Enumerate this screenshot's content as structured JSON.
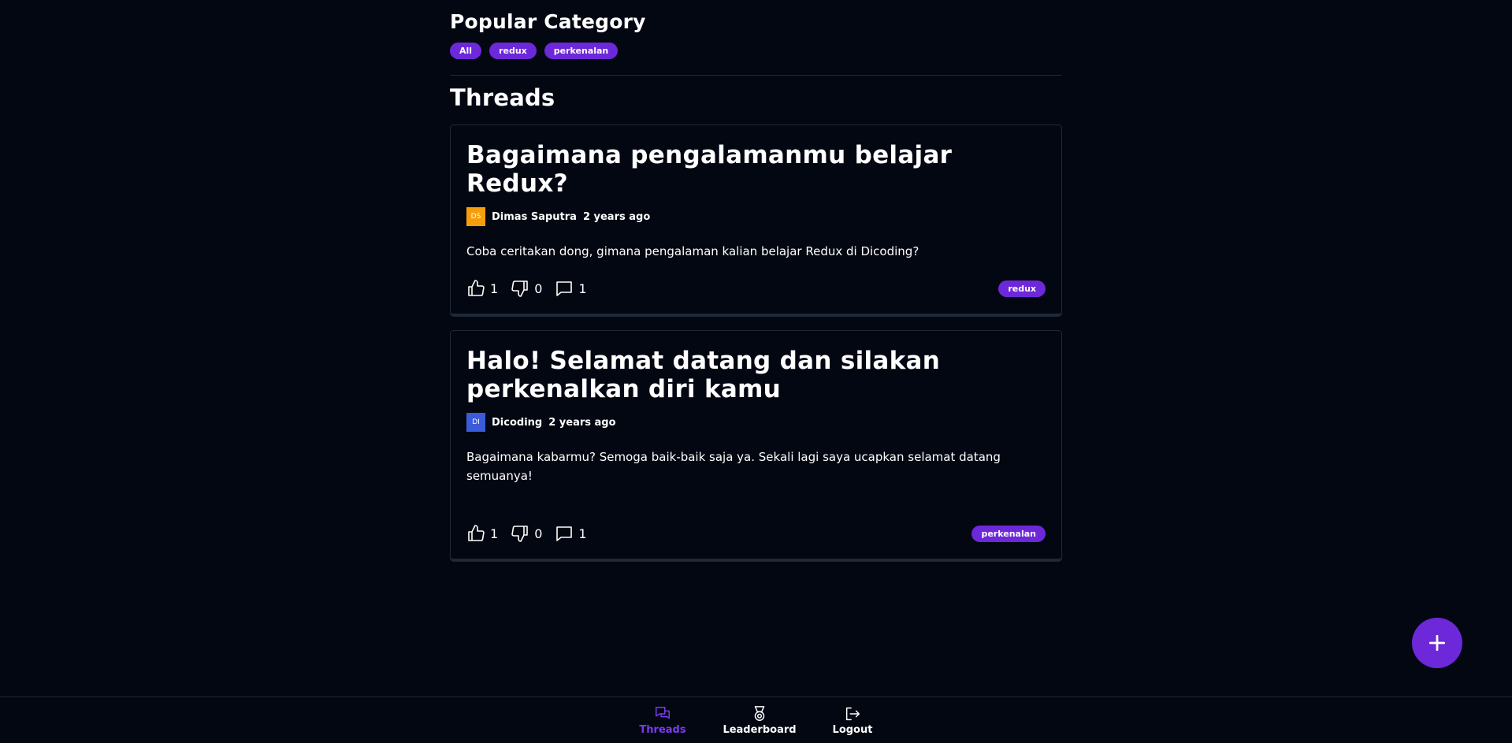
{
  "popular": {
    "title": "Popular Category",
    "categories": [
      "All",
      "redux",
      "perkenalan"
    ]
  },
  "threads_section": {
    "title": "Threads"
  },
  "threads": [
    {
      "title": "Bagaimana pengalamanmu belajar Redux?",
      "author_initials": "DS",
      "author_color": "#f59e0b",
      "author": "Dimas Saputra",
      "time": "2 years ago",
      "body": "Coba ceritakan dong, gimana pengalaman kalian belajar Redux di Dicoding?",
      "likes": "1",
      "dislikes": "0",
      "comments": "1",
      "category": "redux"
    },
    {
      "title": "Halo! Selamat datang dan silakan perkenalkan diri kamu",
      "author_initials": "DI",
      "author_color": "#3b5bdb",
      "author": "Dicoding",
      "time": "2 years ago",
      "body": "Bagaimana kabarmu? Semoga baik-baik saja ya. Sekali lagi saya ucapkan selamat datang semuanya!\n\nSeperti yang sudah disampaikan sebelumnya, pada diskusi ini kamu bisa memperkenalkan diri kamu d...",
      "likes": "1",
      "dislikes": "0",
      "comments": "1",
      "category": "perkenalan"
    }
  ],
  "fab": {
    "icon": "plus-icon"
  },
  "nav": {
    "threads": "Threads",
    "leaderboard": "Leaderboard",
    "logout": "Logout"
  },
  "colors": {
    "accent": "#6d28d9",
    "active_nav": "#7c3aed",
    "background": "#030712"
  }
}
